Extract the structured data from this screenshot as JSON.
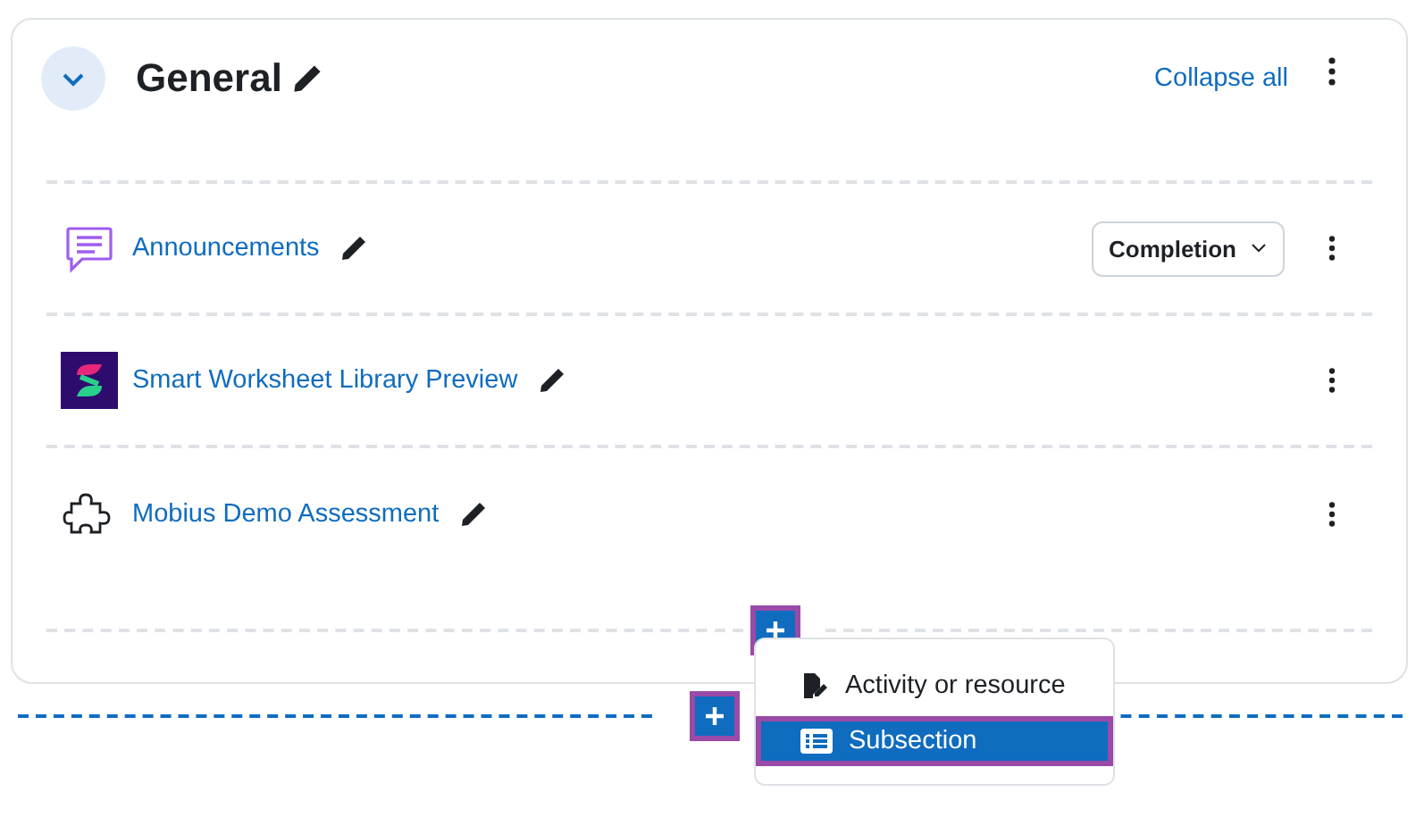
{
  "section": {
    "title": "General",
    "expanded": true,
    "collapse_all": "Collapse all"
  },
  "activities": [
    {
      "kind": "forum",
      "name": "Announcements",
      "completion": "Completion"
    },
    {
      "kind": "app",
      "name": "Smart Worksheet Library Preview"
    },
    {
      "kind": "plugin",
      "name": "Mobius Demo Assessment"
    }
  ],
  "add_menu": {
    "items": [
      {
        "kind": "activity",
        "label": "Activity or resource",
        "selected": false
      },
      {
        "kind": "subsection",
        "label": "Subsection",
        "selected": true
      }
    ]
  }
}
